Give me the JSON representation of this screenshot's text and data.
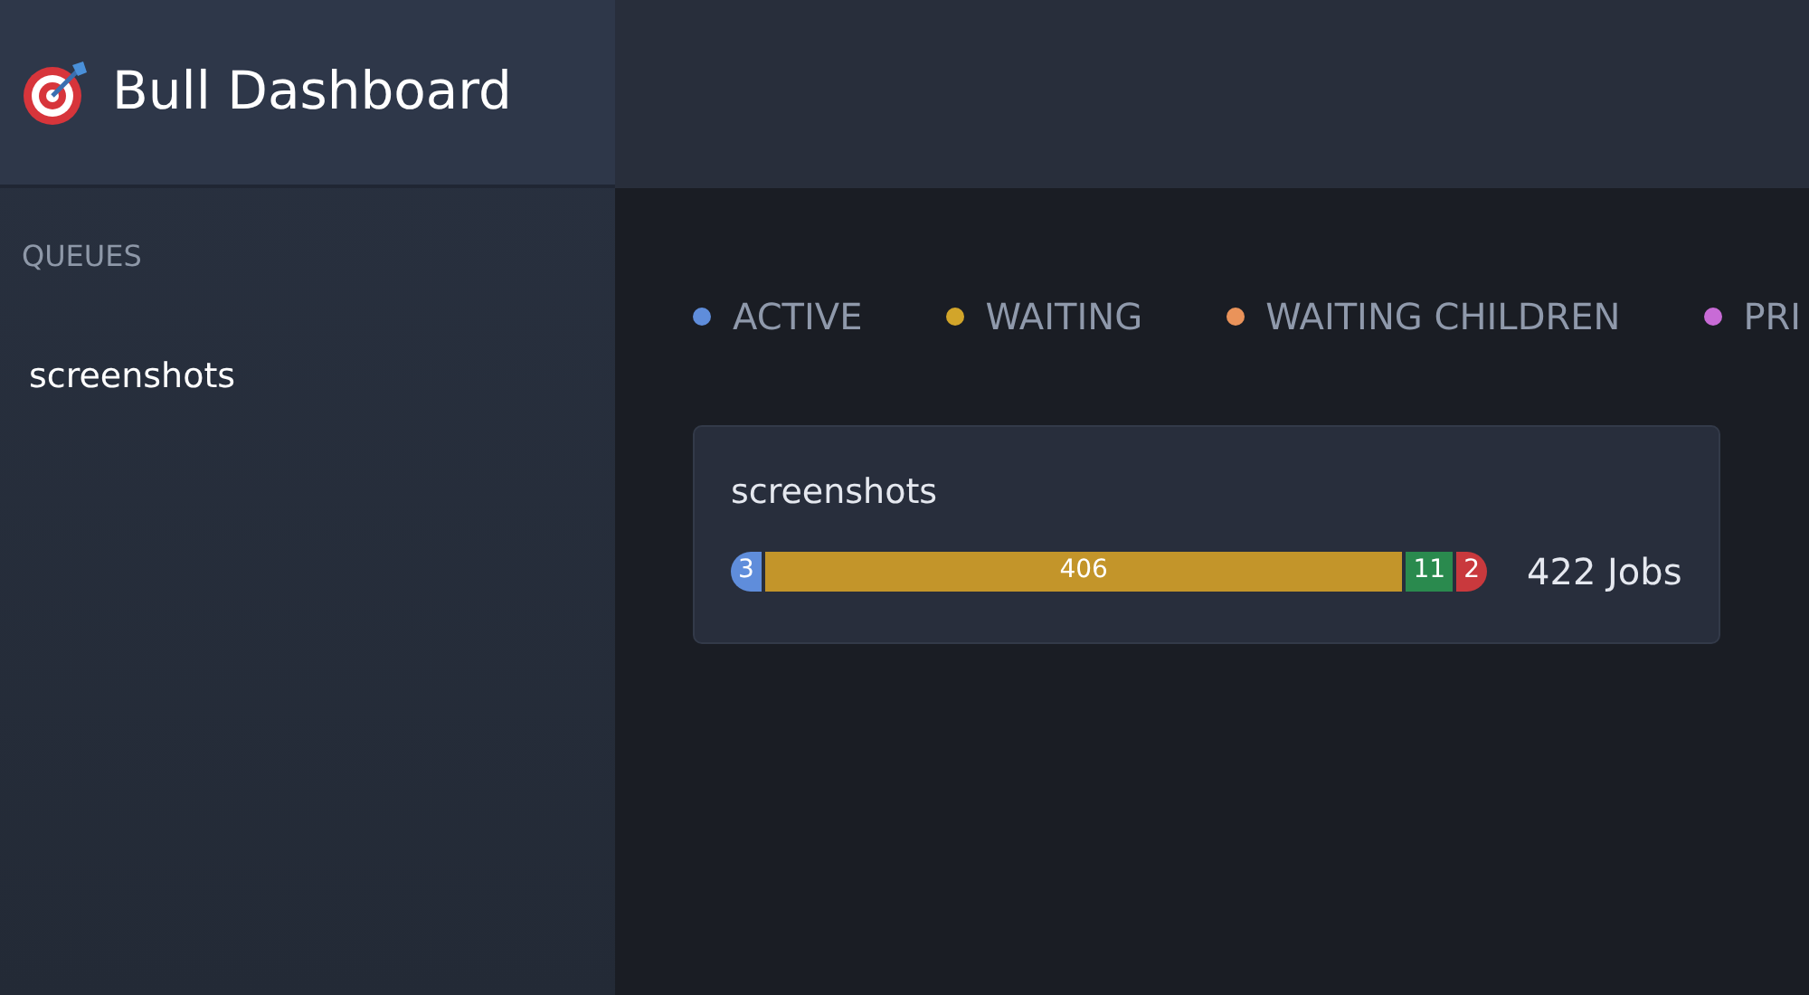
{
  "app": {
    "title": "Bull Dashboard"
  },
  "sidebar": {
    "heading": "QUEUES",
    "items": [
      {
        "label": "screenshots",
        "selected": false
      }
    ]
  },
  "legend": [
    {
      "label": "ACTIVE",
      "color": "#5f8ddb"
    },
    {
      "label": "WAITING",
      "color": "#d2a52a"
    },
    {
      "label": "WAITING CHILDREN",
      "color": "#ea935a"
    },
    {
      "label": "PRI",
      "color": "#c86bd6"
    }
  ],
  "queues": [
    {
      "name": "screenshots",
      "total": "422 Jobs",
      "segments": [
        {
          "label": "3",
          "color": "#5f8ddb"
        },
        {
          "label": "406",
          "color": "#c3952a"
        },
        {
          "label": "11",
          "color": "#2a8a4e"
        },
        {
          "label": "2",
          "color": "#c9393d"
        }
      ]
    }
  ]
}
